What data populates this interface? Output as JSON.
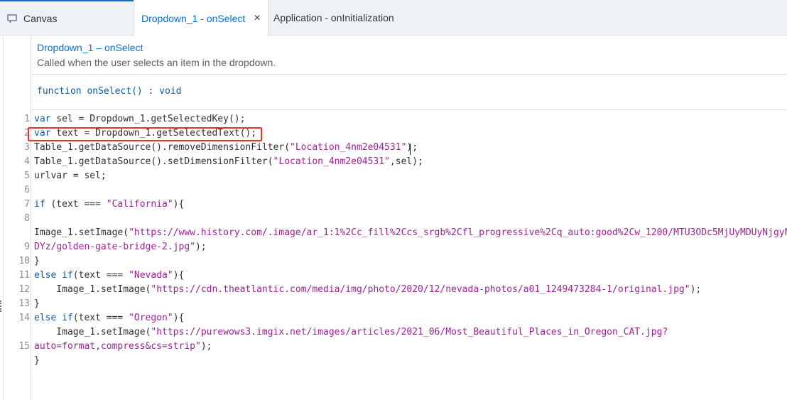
{
  "tabs": {
    "canvas": "Canvas",
    "onselect": "Dropdown_1 - onSelect",
    "oninit": "Application - onInitialization",
    "close_glyph": "×"
  },
  "event": {
    "title": "Dropdown_1 – onSelect",
    "description": "Called when the user selects an item in the dropdown.",
    "sig_kw": "function",
    "sig_name": " onSelect() : ",
    "sig_ret": "void"
  },
  "code": {
    "line_numbers": [
      "1",
      "2",
      "3",
      "4",
      "5",
      "6",
      "7",
      "8",
      "",
      "9",
      "10",
      "11",
      "12",
      "13",
      "14",
      "",
      "15"
    ],
    "lines": [
      [
        [
          "kw",
          "var"
        ],
        [
          "t",
          " sel = Dropdown_1.getSelectedKey();"
        ]
      ],
      [
        [
          "kw",
          "var"
        ],
        [
          "t",
          " text = Dropdown_1.getSelectedText();"
        ]
      ],
      [
        [
          "t",
          "Table_1.getDataSource().removeDimensionFilter("
        ],
        [
          "s",
          "\"Location_4nm2e04531\""
        ],
        [
          "t",
          ");"
        ]
      ],
      [
        [
          "t",
          "Table_1.getDataSource().setDimensionFilter("
        ],
        [
          "s",
          "\"Location_4nm2e04531\""
        ],
        [
          "t",
          ",sel);"
        ]
      ],
      [
        [
          "t",
          "urlvar = sel;"
        ]
      ],
      [],
      [
        [
          "kw",
          "if"
        ],
        [
          "t",
          " (text === "
        ],
        [
          "s",
          "\"California\""
        ],
        [
          "t",
          "){"
        ]
      ],
      [],
      [
        [
          "t",
          "Image_1.setImage("
        ],
        [
          "s",
          "\"https://www.history.com/.image/ar_1:1%2Cc_fill%2Ccs_srgb%2Cfl_progressive%2Cq_auto:good%2Cw_1200/MTU3ODc5MjUyMDUyNjgyN"
        ]
      ],
      [
        [
          "s",
          "DYz/golden-gate-bridge-2.jpg\""
        ],
        [
          "t",
          ");"
        ]
      ],
      [
        [
          "t",
          "}"
        ]
      ],
      [
        [
          "kw",
          "else if"
        ],
        [
          "t",
          "(text === "
        ],
        [
          "s",
          "\"Nevada\""
        ],
        [
          "t",
          "){"
        ]
      ],
      [
        [
          "t",
          "    Image_1.setImage("
        ],
        [
          "s",
          "\"https://cdn.theatlantic.com/media/img/photo/2020/12/nevada-photos/a01_1249473284-1/original.jpg\""
        ],
        [
          "t",
          ");"
        ]
      ],
      [
        [
          "t",
          "}"
        ]
      ],
      [
        [
          "kw",
          "else if"
        ],
        [
          "t",
          "(text === "
        ],
        [
          "s",
          "\"Oregon\""
        ],
        [
          "t",
          "){"
        ]
      ],
      [
        [
          "t",
          "    Image_1.setImage("
        ],
        [
          "s",
          "\"https://purewows3.imgix.net/images/articles/2021_06/Most_Beautiful_Places_in_Oregon_CAT.jpg?"
        ]
      ],
      [
        [
          "s",
          "auto=format,compress&cs=strip\""
        ],
        [
          "t",
          ");"
        ]
      ],
      [
        [
          "t",
          "}"
        ]
      ]
    ]
  }
}
